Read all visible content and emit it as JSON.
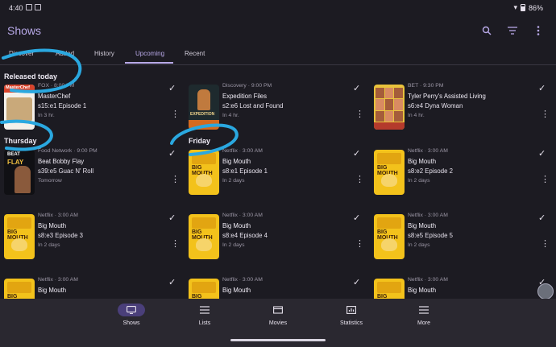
{
  "status": {
    "time": "4:40",
    "battery": "86%"
  },
  "appbar": {
    "title": "Shows",
    "icons": [
      "search-icon",
      "filter-icon",
      "more-vert-icon"
    ]
  },
  "tabs": [
    {
      "label": "Discover"
    },
    {
      "label": "Added"
    },
    {
      "label": "History"
    },
    {
      "label": "Upcoming",
      "active": true
    },
    {
      "label": "Recent"
    }
  ],
  "sections": {
    "released_today": "Released today",
    "thursday": "Thursday",
    "friday": "Friday"
  },
  "cards": [
    {
      "meta": "FOX · 8:00 PM",
      "title": "MasterChef",
      "episode": "s15:e1 Episode 1",
      "when": "In 3 hr.",
      "poster_text": "MasterChef"
    },
    {
      "meta": "Discovery · 9:00 PM",
      "title": "Expedition Files",
      "episode": "s2:e6 Lost and Found",
      "when": "In 4 hr.",
      "poster_text": "EXPEDITION"
    },
    {
      "meta": "BET · 9:30 PM",
      "title": "Tyler Perry's Assisted Living",
      "episode": "s6:e4 Dyna Woman",
      "when": "In 4 hr."
    },
    {
      "meta": "Food Network · 9:00 PM",
      "title": "Beat Bobby Flay",
      "episode": "s39:e5 Guac N' Roll",
      "when": "Tomorrow",
      "poster_text_1": "BEAT",
      "poster_text_2": "FLAY"
    },
    {
      "meta": "Netflix · 3:00 AM",
      "title": "Big Mouth",
      "episode": "s8:e1 Episode 1",
      "when": "In 2 days",
      "poster_text": "BIG MOUTH"
    },
    {
      "meta": "Netflix · 3:00 AM",
      "title": "Big Mouth",
      "episode": "s8:e2 Episode 2",
      "when": "In 2 days",
      "poster_text": "BIG MOUTH"
    },
    {
      "meta": "Netflix · 3:00 AM",
      "title": "Big Mouth",
      "episode": "s8:e3 Episode 3",
      "when": "In 2 days",
      "poster_text": "BIG MOUTH"
    },
    {
      "meta": "Netflix · 3:00 AM",
      "title": "Big Mouth",
      "episode": "s8:e4 Episode 4",
      "when": "In 2 days",
      "poster_text": "BIG MOUTH"
    },
    {
      "meta": "Netflix · 3:00 AM",
      "title": "Big Mouth",
      "episode": "s8:e5 Episode 5",
      "when": "In 2 days",
      "poster_text": "BIG MOUTH"
    },
    {
      "meta": "Netflix · 3:00 AM",
      "title": "Big Mouth",
      "episode": "",
      "when": "",
      "poster_text": "BIG MOUTH"
    },
    {
      "meta": "Netflix · 3:00 AM",
      "title": "Big Mouth",
      "episode": "",
      "when": "",
      "poster_text": "BIG MOUTH"
    },
    {
      "meta": "Netflix · 3:00 AM",
      "title": "Big Mouth",
      "episode": "",
      "when": "",
      "poster_text": "BIG MOUTH"
    }
  ],
  "nav": [
    {
      "label": "Shows",
      "icon": "tv-icon",
      "active": true
    },
    {
      "label": "Lists",
      "icon": "list-icon"
    },
    {
      "label": "Movies",
      "icon": "movie-icon"
    },
    {
      "label": "Statistics",
      "icon": "chart-icon"
    },
    {
      "label": "More",
      "icon": "menu-icon"
    }
  ],
  "colors": {
    "accent": "#b8a9e8",
    "background": "#1c1b22",
    "annotation": "#2aa8e0"
  }
}
